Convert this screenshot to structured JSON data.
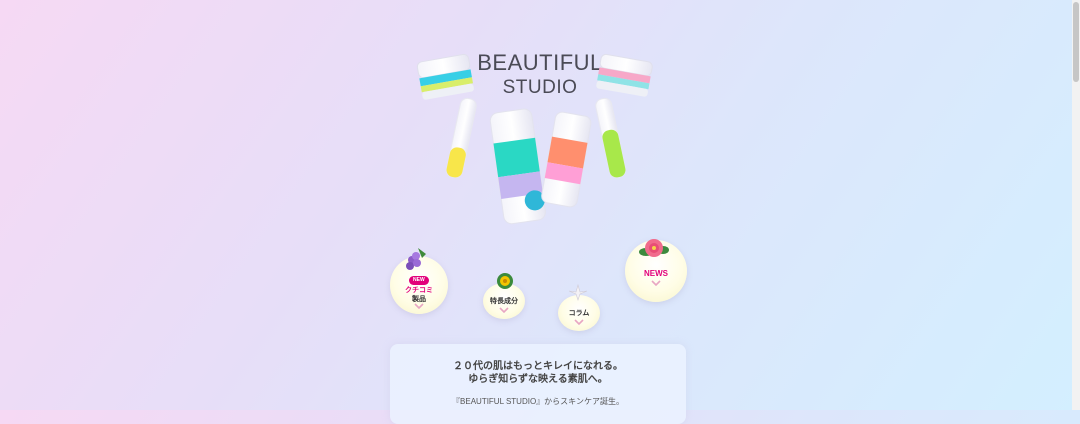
{
  "brand": {
    "line1": "BEAUTIFUL",
    "line2": "STUDIO"
  },
  "nav": {
    "review": {
      "badge": "NEW",
      "line1": "クチコミ",
      "line2": "製品"
    },
    "ingredients": {
      "label": "特長成分"
    },
    "column": {
      "label": "コラム"
    },
    "news": {
      "label": "NEWS"
    }
  },
  "intro": {
    "line1": "２０代の肌はもっとキレイになれる。",
    "line2": "ゆらぎ知らずな映える素肌へ。",
    "line3": "『BEAUTIFUL STUDIO』からスキンケア誕生。"
  },
  "colors": {
    "accent_pink": "#e2007a",
    "chevron": "#e8a6c3",
    "text": "#4a4a55"
  }
}
